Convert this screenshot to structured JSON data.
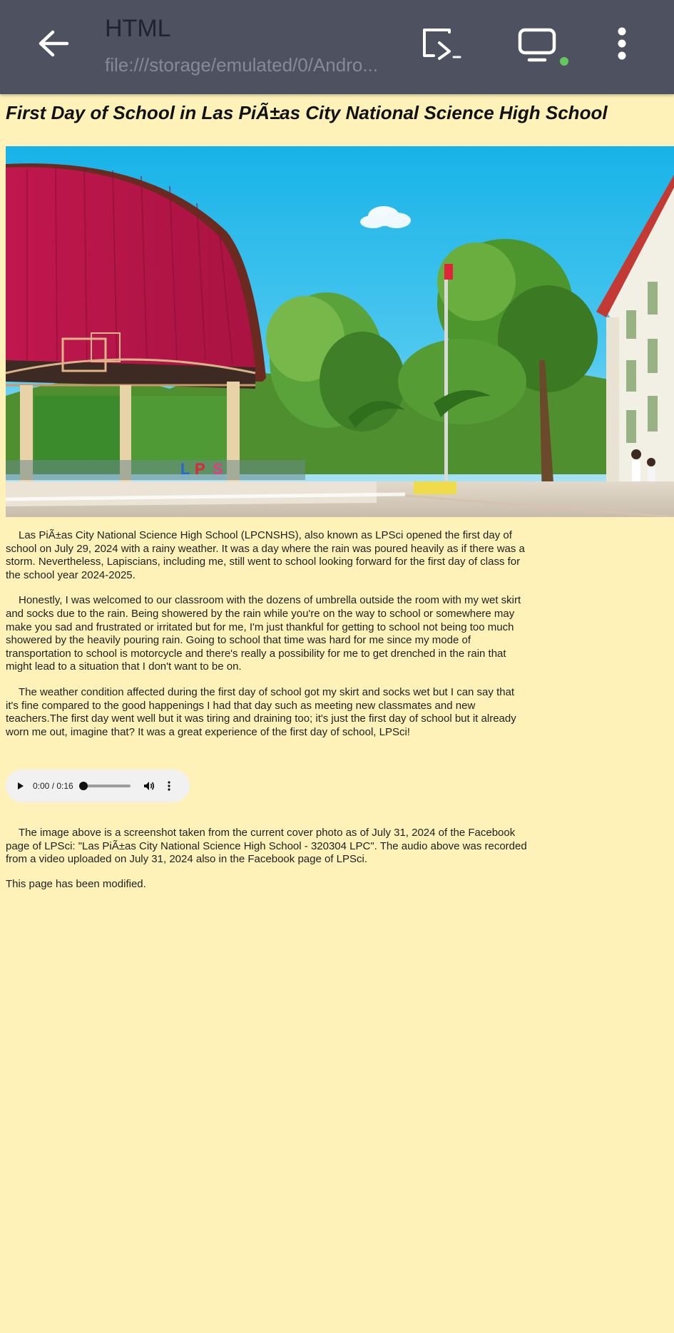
{
  "app_bar": {
    "title": "HTML",
    "url": "file:///storage/emulated/0/Andro...",
    "icons": {
      "back": "arrow-left-icon",
      "cast": "cast-icon",
      "screen": "monitor-icon",
      "menu": "more-vertical-icon"
    },
    "status_dot_color": "#63c85a"
  },
  "page": {
    "title": "First Day of School in Las PiÃ±as City National Science High School",
    "background_color": "#fff2b8",
    "paragraphs": [
      "Las PiÃ±as City National Science High School (LPCNSHS), also known as LPSci opened the first day of school on July 29, 2024 with a rainy weather. It was a day where the rain was poured heavily as if there was a storm. Nevertheless, Lapiscians, including me, still went to school looking forward for the first day of class for the school year 2024-2025.",
      "Honestly, I was welcomed to our classroom with the dozens of umbrella outside the room with my wet skirt and socks due to the rain. Being showered by the rain while you're on the way to school or somewhere may make you sad and frustrated or irritated but for me, I'm just thankful for getting to school not being too much showered by the heavily pouring rain. Going to school that time was hard for me since my mode of transportation to school is motorcycle and there's really a possibility for me to get drenched in the rain that might lead to a situation that I don't want to be on.",
      "The weather condition affected during the first day of school got my skirt and socks wet but I can say that it's fine compared to the good happenings I had that day such as meeting new classmates and new teachers.The first day went well but it was tiring and draining too; it's just the first day of school but it already worn me out, imagine that? It was a great experience of the first day of school, LPSci!"
    ],
    "audio": {
      "time_label": "0:00 / 0:16",
      "progress_fraction": 0.0
    },
    "note": "The image above is a screenshot taken from the current cover photo as of July 31, 2024 of the Facebook page of LPSci: \"Las PiÃ±as City National Science High School - 320304 LPC\". The audio above was recorded from a video uploaded on July 31, 2024 also in the Facebook page of LPSci.",
    "footer": "This page has been modified."
  }
}
